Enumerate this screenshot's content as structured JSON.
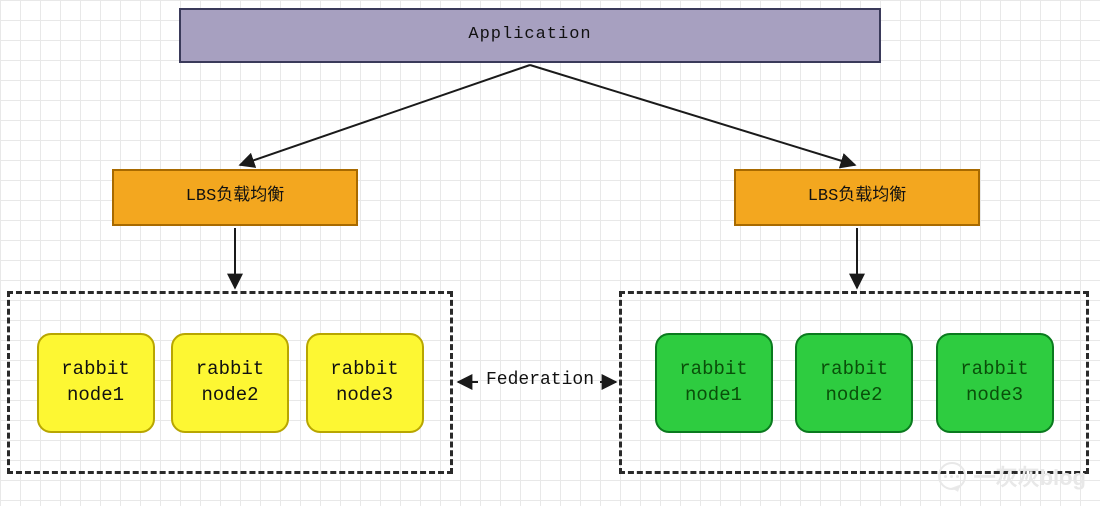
{
  "application": {
    "label": "Application"
  },
  "lbs": {
    "left_label": "LBS负载均衡",
    "right_label": "LBS负载均衡"
  },
  "clusters": {
    "left": {
      "nodes": [
        {
          "line1": "rabbit",
          "line2": "node1"
        },
        {
          "line1": "rabbit",
          "line2": "node2"
        },
        {
          "line1": "rabbit",
          "line2": "node3"
        }
      ]
    },
    "right": {
      "nodes": [
        {
          "line1": "rabbit",
          "line2": "node1"
        },
        {
          "line1": "rabbit",
          "line2": "node2"
        },
        {
          "line1": "rabbit",
          "line2": "node3"
        }
      ]
    }
  },
  "federation": {
    "label": "Federation"
  },
  "watermark": {
    "text": "一灰灰blog"
  },
  "colors": {
    "app_fill": "#a7a0c0",
    "lbs_fill": "#f3a71f",
    "node_yellow": "#fdf733",
    "node_green": "#2ecc40",
    "line": "#1a1a1a"
  }
}
